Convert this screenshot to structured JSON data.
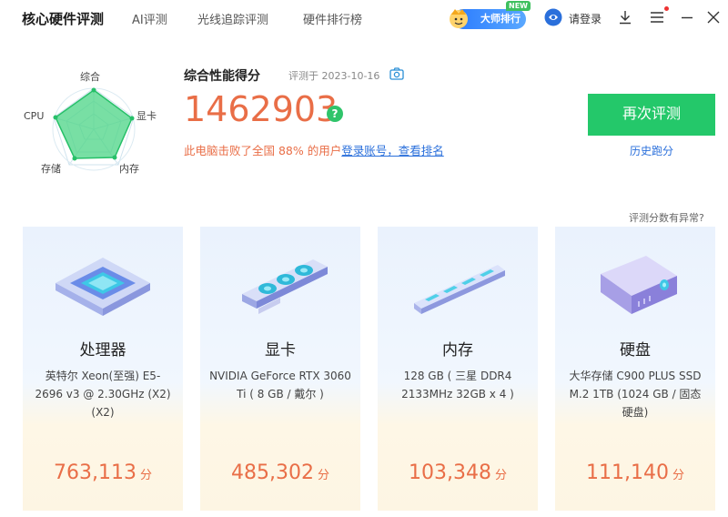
{
  "app_title": "核心硬件评测",
  "tabs": [
    "AI评测",
    "光线追踪评测",
    "硬件排行榜"
  ],
  "rank_badge": {
    "label": "大师排行",
    "tag": "NEW"
  },
  "login": {
    "label": "请登录"
  },
  "icons": {
    "download": "download-icon",
    "menu": "menu-icon",
    "minimize": "minimize-icon",
    "close": "close-icon",
    "camera": "camera-icon",
    "help": "help-icon",
    "user": "user-icon"
  },
  "colors": {
    "accent_green": "#24c86a",
    "score_orange": "#e96e47",
    "link_blue": "#2a6fdb"
  },
  "radar": {
    "labels": {
      "top": "综合",
      "right": "显卡",
      "bottom_right": "内存",
      "bottom_left": "存储",
      "left": "CPU"
    }
  },
  "summary": {
    "label": "综合性能得分",
    "eval_date": "评测于 2023-10-16",
    "total_score": "1462903",
    "help_glyph": "?",
    "beat_text": "此电脑击败了全国 88% 的用户",
    "beat_link": "登录账号，查看排名",
    "retest_button": "再次评测",
    "history_link": "历史跑分",
    "abnormal_link": "评测分数有异常?"
  },
  "cards": [
    {
      "name": "处理器",
      "desc": "英特尔 Xeon(至强) E5-2696 v3 @ 2.30GHz (X2) (X2)",
      "score": "763,113",
      "unit": "分",
      "icon": "cpu-icon"
    },
    {
      "name": "显卡",
      "desc": "NVIDIA GeForce RTX 3060 Ti ( 8 GB / 戴尔 )",
      "score": "485,302",
      "unit": "分",
      "icon": "gpu-icon"
    },
    {
      "name": "内存",
      "desc": "128 GB ( 三星 DDR4 2133MHz 32GB x 4 )",
      "score": "103,348",
      "unit": "分",
      "icon": "ram-icon"
    },
    {
      "name": "硬盘",
      "desc": "大华存储 C900 PLUS SSD M.2 1TB (1024 GB / 固态硬盘)",
      "score": "111,140",
      "unit": "分",
      "icon": "ssd-icon"
    }
  ]
}
